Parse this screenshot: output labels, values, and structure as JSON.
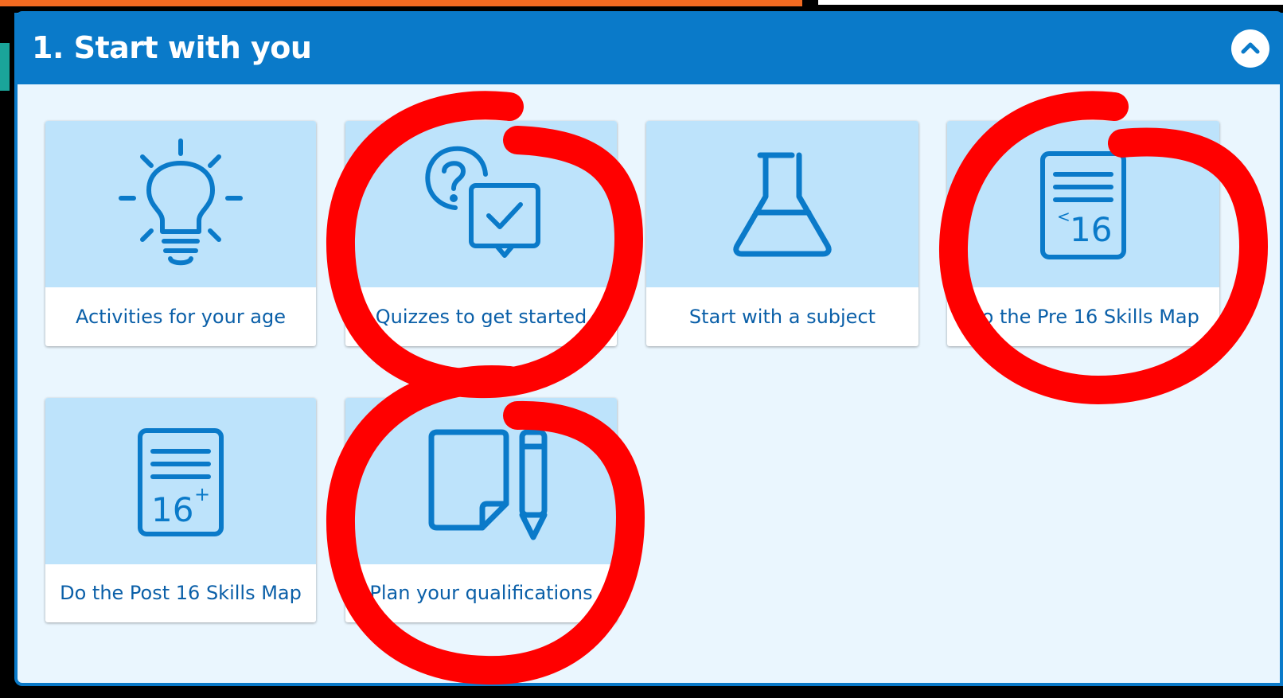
{
  "panel": {
    "title": "1. Start with you",
    "collapse_icon": "chevron-up-icon",
    "cards": [
      {
        "label": "Activities for your age",
        "icon": "lightbulb-icon"
      },
      {
        "label": "Quizzes to get started",
        "icon": "quiz-icon"
      },
      {
        "label": "Start with a subject",
        "icon": "flask-icon"
      },
      {
        "label": "Do the Pre 16 Skills Map",
        "icon": "pre16-document-icon",
        "icon_text": "16",
        "icon_mark": "<"
      },
      {
        "label": "Do the Post 16 Skills Map",
        "icon": "post16-document-icon",
        "icon_text": "16",
        "icon_mark": "+"
      },
      {
        "label": "Plan your qualifications",
        "icon": "paper-pencil-icon"
      }
    ]
  },
  "colors": {
    "header_blue": "#0a7ac9",
    "panel_bg": "#eaf6fe",
    "card_top": "#bde3fb",
    "label_blue": "#0a5fa8",
    "annotation_red": "#ff0000"
  }
}
